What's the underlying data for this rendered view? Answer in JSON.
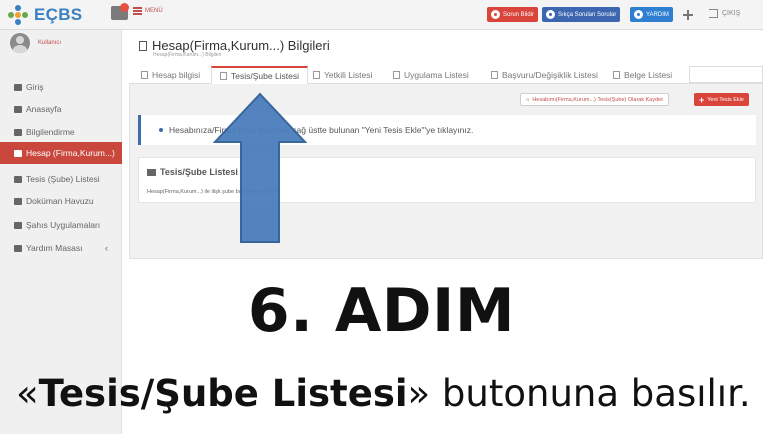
{
  "app": {
    "logo_text": "EÇBS"
  },
  "topbar": {
    "menu_label": "MENÜ",
    "buttons": [
      {
        "label": "Sorun Bildir",
        "icon": "stop-icon",
        "color": "#d9443b"
      },
      {
        "label": "Sıkça Sorulan Sorular",
        "icon": "question-icon",
        "color": "#3d66b0"
      },
      {
        "label": "YARDIM",
        "icon": "help-icon",
        "color": "#2e7fd2"
      }
    ],
    "exit_label": "ÇIKIŞ"
  },
  "sidebar": {
    "user_name": "Kullanıcı",
    "items": [
      {
        "label": "Giriş",
        "icon": "sign-in-icon"
      },
      {
        "label": "Anasayfa",
        "icon": "home-icon"
      },
      {
        "label": "Bilgilendirme",
        "icon": "info-icon"
      },
      {
        "label": "Hesap (Firma,Kurum...)",
        "icon": "building-icon",
        "active": true
      },
      {
        "label": "Tesis (Şube) Listesi",
        "icon": "building-icon"
      },
      {
        "label": "Doküman Havuzu",
        "icon": "folder-icon"
      },
      {
        "label": "Şahıs Uygulamaları",
        "icon": "cloud-icon"
      },
      {
        "label": "Yardım Masası",
        "icon": "envelope-icon"
      }
    ],
    "yardim_caret": "‹"
  },
  "main": {
    "title": "Hesap(Firma,Kurum...) Bilgileri",
    "breadcrumb": "Hesap(Firma,Kurum...) Bilgileri",
    "tabs": [
      {
        "label": "Hesap bilgisi"
      },
      {
        "label": "Tesis/Şube Listesi",
        "active": true
      },
      {
        "label": "Yetkili Listesi"
      },
      {
        "label": "Uygulama Listesi"
      },
      {
        "label": "Başvuru/Değişiklik Listesi"
      },
      {
        "label": "Belge Listesi"
      }
    ],
    "actions": {
      "save_label": "Hesabımı(Firma,Kurum...) Tesis(Şube) Olarak Kaydet",
      "new_label": "Yeni Tesis Ekle"
    },
    "info_text": "Hesabınıza/Firma      tesis eklemek sağ üstte bulunan \"Yeni Tesis Ekle\"'ye tıklayınız.",
    "list": {
      "title": "Tesis/Şube Listesi",
      "empty_text": "Hesap(Firma,Kurum...) ile ilişk               şube bulunmamaktadır."
    }
  },
  "overlay": {
    "step": "6. ADIM",
    "caption_open": "«",
    "caption_bold": "Tesis/Şube Listesi",
    "caption_rest": "» butonuna basılır.",
    "arrow_color": "#4a7ebd"
  }
}
